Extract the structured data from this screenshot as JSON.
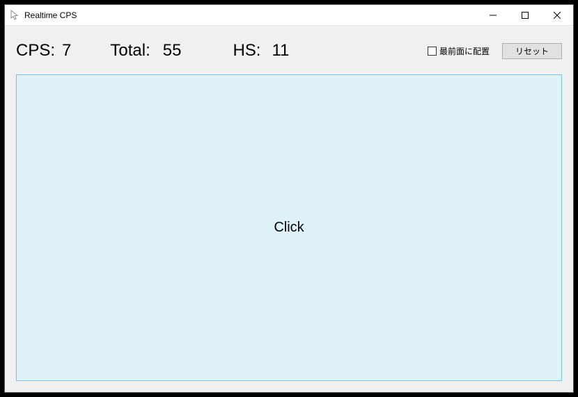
{
  "window": {
    "title": "Realtime CPS"
  },
  "stats": {
    "cps_label": "CPS:",
    "cps_value": "7",
    "total_label": "Total:",
    "total_value": "55",
    "hs_label": "HS:",
    "hs_value": "11"
  },
  "controls": {
    "topmost_label": "最前面に配置",
    "reset_label": "リセット"
  },
  "panel": {
    "click_label": "Click"
  }
}
